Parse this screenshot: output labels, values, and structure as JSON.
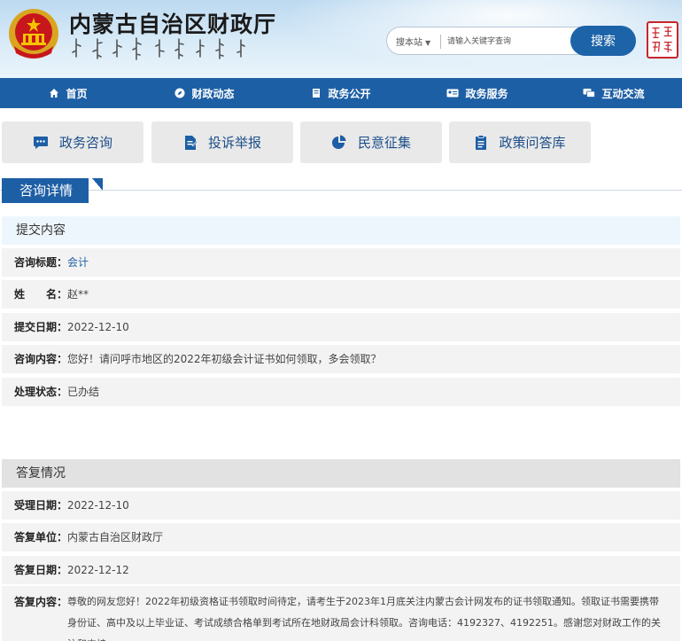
{
  "header": {
    "title": "内蒙古自治区财政厅",
    "search_scope": "搜本站",
    "search_placeholder": "请输入关键字查询",
    "search_button": "搜索",
    "colors": {
      "brand_blue": "#1d5fa5",
      "seal_red": "#c9252b"
    }
  },
  "nav": {
    "items": [
      {
        "label": "首页",
        "icon": "home-icon"
      },
      {
        "label": "财政动态",
        "icon": "compass-icon"
      },
      {
        "label": "政务公开",
        "icon": "book-icon"
      },
      {
        "label": "政务服务",
        "icon": "id-card-icon"
      },
      {
        "label": "互动交流",
        "icon": "chat-icon"
      }
    ]
  },
  "quick_links": [
    {
      "label": "政务咨询",
      "icon": "message-icon"
    },
    {
      "label": "投诉举报",
      "icon": "document-edit-icon"
    },
    {
      "label": "民意征集",
      "icon": "pie-chart-icon"
    },
    {
      "label": "政策问答库",
      "icon": "clipboard-icon"
    }
  ],
  "section_title": "咨询详情",
  "submission": {
    "heading": "提交内容",
    "fields": [
      {
        "label": "咨询标题：",
        "value": "会计"
      },
      {
        "label": "姓　　名：",
        "value": "赵**"
      },
      {
        "label": "提交日期：",
        "value": "2022-12-10"
      },
      {
        "label": "咨询内容：",
        "value": "您好！请问呼市地区的2022年初级会计证书如何领取，多会领取？"
      },
      {
        "label": "处理状态：",
        "value": "已办结"
      }
    ]
  },
  "reply": {
    "heading": "答复情况",
    "fields": [
      {
        "label": "受理日期：",
        "value": "2022-12-10"
      },
      {
        "label": "答复单位：",
        "value": "内蒙古自治区财政厅"
      },
      {
        "label": "答复日期：",
        "value": "2022-12-12"
      },
      {
        "label": "答复内容：",
        "value": "尊敬的网友您好！2022年初级资格证书领取时间待定，请考生于2023年1月底关注内蒙古会计网发布的证书领取通知。领取证书需要携带身份证、高中及以上毕业证、考试成绩合格单到考试所在地财政局会计科领取。咨询电话：4192327、4192251。感谢您对财政工作的关注和支持。"
      }
    ]
  }
}
